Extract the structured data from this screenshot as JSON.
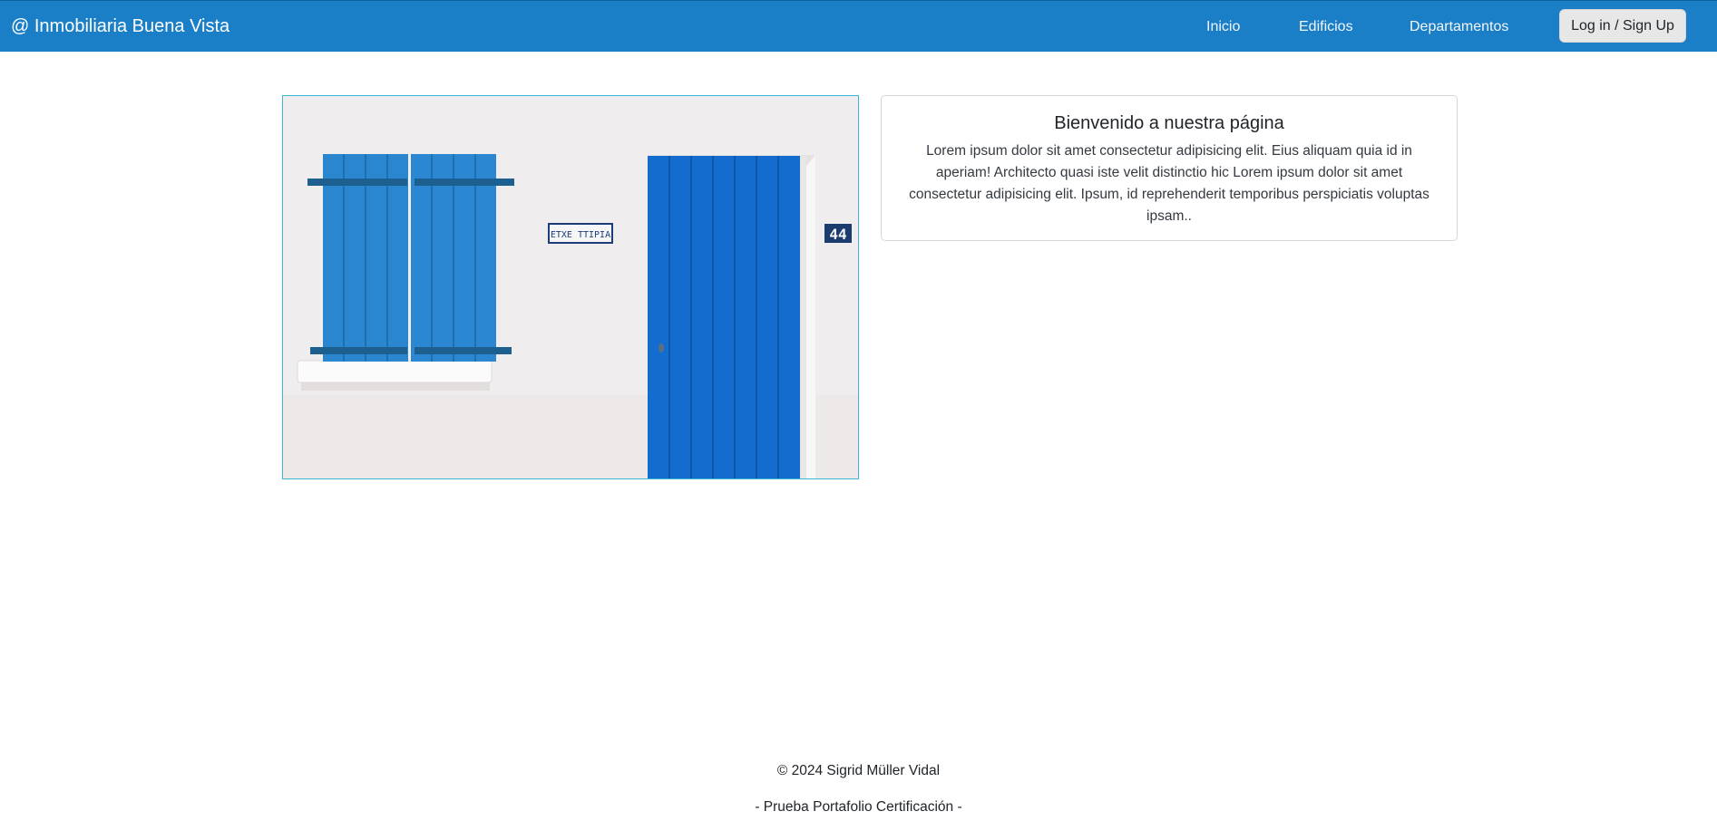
{
  "navbar": {
    "brand": "@ Inmobiliaria Buena Vista",
    "links": [
      {
        "label": "Inicio"
      },
      {
        "label": "Edificios"
      },
      {
        "label": "Departamentos"
      }
    ],
    "login_label": "Log in / Sign Up",
    "background_color": "#1b7fc7"
  },
  "hero": {
    "sign_text": "ETXE TTIPIA",
    "house_number": "44"
  },
  "welcome_card": {
    "title": "Bienvenido a nuestra página",
    "text": "Lorem ipsum dolor sit amet consectetur adipisicing elit. Eius aliquam quia id in aperiam! Architecto quasi iste velit distinctio hic Lorem ipsum dolor sit amet consectetur adipisicing elit. Ipsum, id reprehenderit temporibus perspiciatis voluptas ipsam.."
  },
  "footer": {
    "copyright": "© 2024 Sigrid Müller Vidal",
    "subtitle": "- Prueba Portafolio Certificación -"
  }
}
